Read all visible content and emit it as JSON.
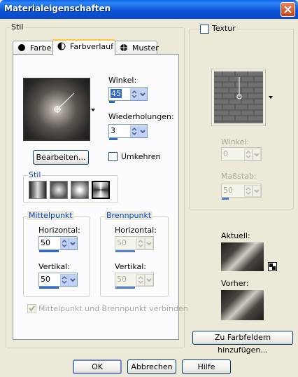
{
  "window": {
    "title": "Materialeigenschaften"
  },
  "stil_group": {
    "legend": "Stil",
    "tabs": [
      {
        "label": "Farbe",
        "icon": "filled-circle-icon"
      },
      {
        "label": "Farbverlauf",
        "icon": "half-circle-icon",
        "active": true
      },
      {
        "label": "Muster",
        "icon": "pattern-icon"
      }
    ],
    "winkel_label": "Winkel:",
    "winkel_value": "45",
    "wiederholungen_label": "Wiederholungen:",
    "wiederholungen_value": "3",
    "bearbeiten_label": "Bearbeiten...",
    "umkehren_label": "Umkehren",
    "umkehren_checked": false,
    "stil_sub": {
      "legend": "Stil",
      "styles": [
        "linear",
        "rectangular",
        "radial",
        "sunburst"
      ]
    },
    "mittelpunkt": {
      "legend": "Mittelpunkt",
      "horizontal_label": "Horizontal:",
      "horizontal_value": "50",
      "vertikal_label": "Vertikal:",
      "vertikal_value": "50"
    },
    "brennpunkt": {
      "legend": "Brennpunkt",
      "horizontal_label": "Horizontal:",
      "horizontal_value": "50",
      "vertikal_label": "Vertikal:",
      "vertikal_value": "50"
    },
    "link_label": "Mittelpunkt und Brennpunkt verbinden",
    "link_checked": true
  },
  "textur_group": {
    "checkbox_label": "Textur",
    "checked": false,
    "winkel_label": "Winkel:",
    "winkel_value": "0",
    "massstab_label": "Maßstab:",
    "massstab_value": "50"
  },
  "preview": {
    "aktuell_label": "Aktuell:",
    "vorher_label": "Vorher:",
    "add_button_label": "Zu Farbfeldern hinzufügen..."
  },
  "buttons": {
    "ok": "OK",
    "cancel": "Abbrechen",
    "help": "Hilfe"
  },
  "colors": {
    "titlebar": "#0A5FE6",
    "selection": "#316AC5",
    "window_bg": "#ECE9D8",
    "group_legend_blue": "#0046D5"
  }
}
